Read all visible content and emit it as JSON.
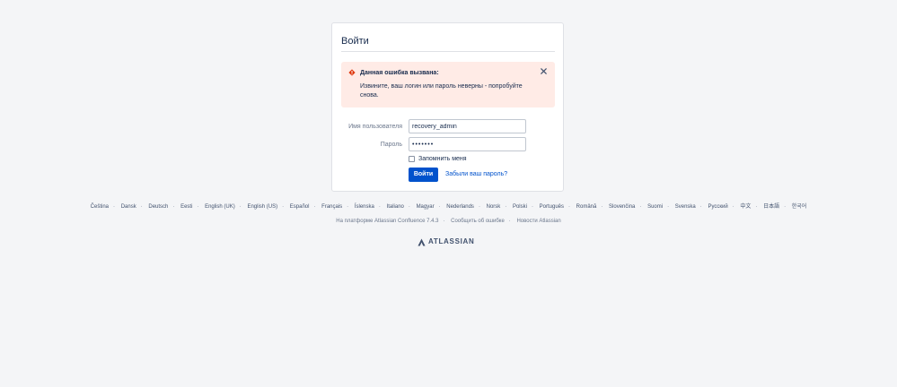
{
  "login": {
    "title": "Войти",
    "error": {
      "heading": "Данная ошибка вызвана:",
      "message": "Извините, ваш логин или пароль неверны - попробуйте снова.",
      "color": "#ffebe6",
      "icon": "error-icon"
    },
    "username": {
      "label": "Имя пользователя",
      "value": "recovery_admin"
    },
    "password": {
      "label": "Пароль",
      "value": "•••••••"
    },
    "remember": {
      "label": "Запомнить меня",
      "checked": false
    },
    "submit_label": "Войти",
    "forgot_label": "Забыли ваш пароль?",
    "accent": "#0052cc"
  },
  "languages": [
    "Čeština",
    "Dansk",
    "Deutsch",
    "Eesti",
    "English (UK)",
    "English (US)",
    "Español",
    "Français",
    "Íslenska",
    "Italiano",
    "Magyar",
    "Nederlands",
    "Norsk",
    "Polski",
    "Português",
    "Română",
    "Slovenčina",
    "Suomi",
    "Svenska",
    "Русский",
    "中文",
    "日本語",
    "한국어"
  ],
  "footer": {
    "powered_by": "На платформе Atlassian Confluence 7.4.3",
    "report_bug": "Сообщить об ошибке",
    "news": "Новости Atlassian",
    "separator": "·"
  },
  "brand": {
    "wordmark": "ATLASSIAN",
    "icon": "atlassian-logo-icon"
  }
}
